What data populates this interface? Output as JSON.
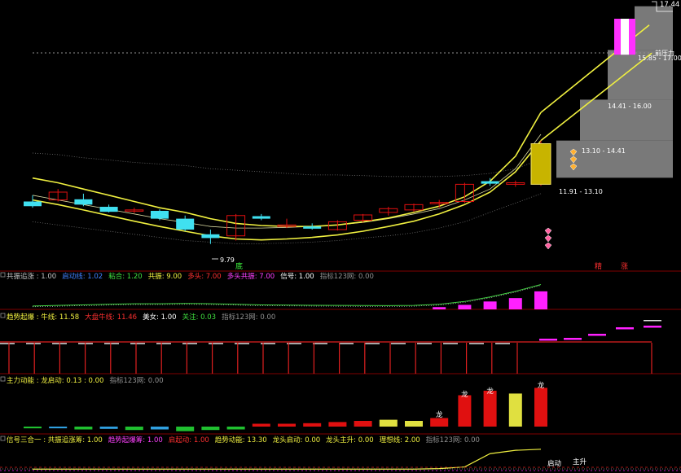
{
  "colors": {
    "bg": "#000000",
    "up": "#e01010",
    "down": "#40e0f0",
    "yellow": "#f0f040",
    "magenta": "#ff20ff",
    "green": "#20d040",
    "gray": "#a0a0a0",
    "white": "#e0e0e0",
    "blue": "#4080ff",
    "separator": "#800000"
  },
  "main_chart": {
    "price_axis_top_label": "17.44",
    "annotations": [
      {
        "text": "15.85 - 17.00",
        "kind": "zone"
      },
      {
        "text": "14.41 - 16.00",
        "kind": "zone"
      },
      {
        "text": "13.10 - 14.41",
        "kind": "zone"
      },
      {
        "text": "11.91 - 13.10",
        "kind": "zone"
      },
      {
        "text": "前压力",
        "kind": "label"
      },
      {
        "text": "9.79",
        "kind": "low"
      },
      {
        "text": "底",
        "kind": "marker"
      },
      {
        "text": "精",
        "kind": "marker"
      },
      {
        "text": "涨",
        "kind": "marker"
      }
    ]
  },
  "panels": [
    {
      "id": "gongzhen",
      "legend": [
        {
          "text": "共振追涨 : 1.00",
          "color": "#c0c0c0"
        },
        {
          "text": "启动线: 1.02",
          "color": "#4080ff"
        },
        {
          "text": "粘合: 1.20",
          "color": "#40e040"
        },
        {
          "text": "共振: 9.00",
          "color": "#f0f040"
        },
        {
          "text": "多头: 7.00",
          "color": "#ff3030"
        },
        {
          "text": "多头共振: 7.00",
          "color": "#ff40ff"
        },
        {
          "text": "信号: 1.00",
          "color": "#ffffff"
        },
        {
          "text": "指标123网: 0.00",
          "color": "#909090"
        }
      ]
    },
    {
      "id": "qushi",
      "legend": [
        {
          "text": "趋势起爆 : 牛线: 11.58",
          "color": "#f0f040"
        },
        {
          "text": "大盘牛线: 11.46",
          "color": "#ff3030"
        },
        {
          "text": "美女: 1.00",
          "color": "#ffffff"
        },
        {
          "text": "关注: 0.03",
          "color": "#40e040"
        },
        {
          "text": "指标123网: 0.00",
          "color": "#909090"
        }
      ]
    },
    {
      "id": "zhuli",
      "legend": [
        {
          "text": "主力动能 : 龙启动: 0.13 : 0.00",
          "color": "#f0f040"
        },
        {
          "text": "指标123网: 0.00",
          "color": "#909090"
        }
      ],
      "bar_labels": [
        "龙",
        "龙",
        "龙",
        "龙"
      ]
    },
    {
      "id": "xinhao",
      "legend": [
        {
          "text": "信号三合一 : 共振追涨筹: 1.00",
          "color": "#f0f040"
        },
        {
          "text": "趋势起爆筹: 1.00",
          "color": "#ff40ff"
        },
        {
          "text": "启起动: 1.00",
          "color": "#ff3030"
        },
        {
          "text": "趋势动能: 13.30",
          "color": "#f0f040"
        },
        {
          "text": "龙头启动: 0.00",
          "color": "#f0f040"
        },
        {
          "text": "龙头主升: 0.00",
          "color": "#f0f040"
        },
        {
          "text": "理想线: 2.00",
          "color": "#f0f040"
        },
        {
          "text": "指标123网: 0.00",
          "color": "#909090"
        }
      ],
      "marks": [
        "启动",
        "主升"
      ]
    }
  ],
  "chart_data": [
    {
      "type": "candlestick",
      "panel": "main",
      "ylim": [
        9.0,
        17.6
      ],
      "candles": [
        {
          "o": 11.15,
          "h": 11.35,
          "l": 10.95,
          "c": 11.0
        },
        {
          "o": 11.2,
          "h": 11.55,
          "l": 11.15,
          "c": 11.45
        },
        {
          "o": 11.22,
          "h": 11.4,
          "l": 11.0,
          "c": 11.05
        },
        {
          "o": 10.98,
          "h": 11.05,
          "l": 10.8,
          "c": 10.82
        },
        {
          "o": 10.85,
          "h": 10.95,
          "l": 10.78,
          "c": 10.88
        },
        {
          "o": 10.85,
          "h": 10.9,
          "l": 10.55,
          "c": 10.6
        },
        {
          "o": 10.6,
          "h": 10.7,
          "l": 10.2,
          "c": 10.25
        },
        {
          "o": 10.1,
          "h": 10.25,
          "l": 9.79,
          "c": 9.98
        },
        {
          "o": 10.05,
          "h": 10.75,
          "l": 9.9,
          "c": 10.7
        },
        {
          "o": 10.68,
          "h": 10.75,
          "l": 10.55,
          "c": 10.6
        },
        {
          "o": 10.35,
          "h": 10.6,
          "l": 10.3,
          "c": 10.4
        },
        {
          "o": 10.35,
          "h": 10.45,
          "l": 10.25,
          "c": 10.28
        },
        {
          "o": 10.25,
          "h": 10.55,
          "l": 10.22,
          "c": 10.5
        },
        {
          "o": 10.55,
          "h": 10.75,
          "l": 10.48,
          "c": 10.72
        },
        {
          "o": 10.8,
          "h": 10.98,
          "l": 10.7,
          "c": 10.92
        },
        {
          "o": 10.88,
          "h": 11.08,
          "l": 10.82,
          "c": 11.05
        },
        {
          "o": 11.08,
          "h": 11.2,
          "l": 10.95,
          "c": 11.12
        },
        {
          "o": 11.15,
          "h": 11.75,
          "l": 11.1,
          "c": 11.7
        },
        {
          "o": 11.8,
          "h": 11.9,
          "l": 11.65,
          "c": 11.72
        },
        {
          "o": 11.7,
          "h": 11.82,
          "l": 11.62,
          "c": 11.75
        },
        {
          "o": 11.7,
          "h": 13.1,
          "l": 11.65,
          "c": 13.0
        }
      ],
      "ma_yellow": [
        11.9,
        11.75,
        11.55,
        11.35,
        11.15,
        10.95,
        10.8,
        10.6,
        10.45,
        10.38,
        10.35,
        10.35,
        10.4,
        10.5,
        10.62,
        10.8,
        11.0,
        11.3,
        11.8,
        12.6,
        14.0
      ],
      "ma_inner": [
        11.35,
        11.2,
        11.05,
        10.9,
        10.75,
        10.6,
        10.48,
        10.35,
        10.3,
        10.3,
        10.32,
        10.35,
        10.4,
        10.48,
        10.6,
        10.75,
        10.92,
        11.2,
        11.55,
        12.2,
        13.3
      ],
      "ma_lower": [
        11.2,
        11.05,
        10.88,
        10.7,
        10.52,
        10.35,
        10.2,
        10.05,
        9.95,
        9.92,
        9.95,
        10.0,
        10.08,
        10.2,
        10.35,
        10.52,
        10.75,
        11.05,
        11.45,
        12.1,
        13.1
      ],
      "band_upper_dotted": [
        12.7,
        12.65,
        12.55,
        12.48,
        12.4,
        12.35,
        12.3,
        12.2,
        12.15,
        12.1,
        12.05,
        12.0,
        12.0,
        11.98,
        11.95,
        11.95,
        11.95,
        11.98,
        12.05,
        12.2,
        12.5
      ],
      "band_lower_dotted": [
        10.5,
        10.4,
        10.3,
        10.2,
        10.1,
        10.0,
        9.9,
        9.85,
        9.8,
        9.8,
        9.82,
        9.85,
        9.9,
        9.98,
        10.05,
        10.15,
        10.3,
        10.5,
        10.8,
        11.1,
        11.4
      ]
    },
    {
      "type": "bar",
      "panel": "gongzhen",
      "values": [
        0,
        0,
        0,
        0,
        0,
        0,
        0,
        0,
        0,
        0,
        0,
        0,
        0,
        0,
        0,
        0,
        0.2,
        0.4,
        0.7,
        1.0,
        1.6
      ],
      "line_green": [
        0.3,
        0.35,
        0.4,
        0.45,
        0.5,
        0.5,
        0.52,
        0.5,
        0.45,
        0.4,
        0.38,
        0.36,
        0.35,
        0.34,
        0.33,
        0.35,
        0.45,
        0.7,
        1.1,
        1.6,
        2.2
      ],
      "ylim": [
        0,
        2.6
      ]
    },
    {
      "type": "bar",
      "panel": "qushi",
      "values": [
        1,
        1,
        1,
        1,
        1,
        1,
        1,
        1,
        1,
        1,
        1,
        1,
        1,
        1,
        1,
        1,
        1,
        1,
        1,
        1,
        1
      ],
      "ylim": [
        0,
        1.2
      ]
    },
    {
      "type": "bar",
      "panel": "zhuli",
      "values": [
        -0.3,
        -0.3,
        -0.5,
        -0.4,
        -0.6,
        -0.5,
        -0.8,
        -0.6,
        -0.5,
        0.5,
        0.5,
        0.6,
        0.8,
        1.0,
        1.2,
        1.0,
        1.5,
        5.5,
        6.3,
        5.8,
        6.8
      ],
      "colors": [
        "green",
        "blue",
        "green",
        "blue",
        "green",
        "blue",
        "green",
        "green",
        "green",
        "red",
        "red",
        "red",
        "red",
        "red",
        "yellow",
        "yellow",
        "red",
        "red",
        "red",
        "yellow",
        "red"
      ],
      "ylim": [
        -1,
        7.2
      ]
    },
    {
      "type": "line",
      "panel": "xinhao",
      "values": [
        0.2,
        0.2,
        0.2,
        0.2,
        0.2,
        0.2,
        0.2,
        0.2,
        0.2,
        0.2,
        0.2,
        0.2,
        0.2,
        0.2,
        0.2,
        0.2,
        0.25,
        0.4,
        1.6,
        1.9,
        2.0
      ],
      "ylim": [
        0,
        2.5
      ]
    }
  ]
}
